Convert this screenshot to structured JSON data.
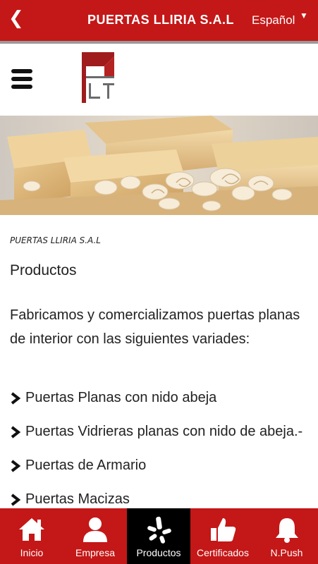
{
  "topbar": {
    "back_icon": "chevron-left-icon",
    "title": "PUERTAS LLIRIA S.A.L",
    "language": "Español",
    "language_caret": "▼"
  },
  "content": {
    "subtitle": "PUERTAS LLIRIA S.A.L",
    "heading": "Productos",
    "paragraph": "Fabricamos y comercializamos puertas planas de interior con las siguientes variades:",
    "items": [
      "Puertas Planas con nido abeja",
      "Puertas Vidrieras planas con nido de abeja.-",
      "Puertas de Armario",
      "Puertas Macizas"
    ]
  },
  "tabbar": {
    "active": "Productos",
    "tabs": [
      {
        "label": "Inicio",
        "icon": "home-icon"
      },
      {
        "label": "Empresa",
        "icon": "user-icon"
      },
      {
        "label": "Productos",
        "icon": "yelp-icon"
      },
      {
        "label": "Certificados",
        "icon": "thumbs-up-icon"
      },
      {
        "label": "N.Push",
        "icon": "bell-icon"
      }
    ]
  },
  "colors": {
    "brand_red": "#c41717",
    "active_tab": "#000000"
  }
}
